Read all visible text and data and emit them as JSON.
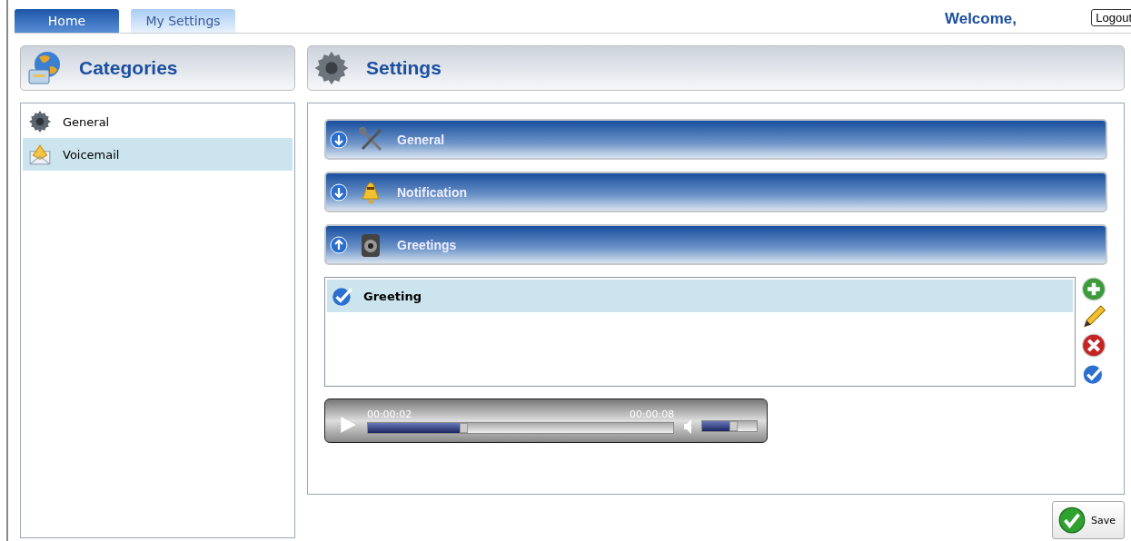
{
  "tabs": [
    {
      "label": "Home",
      "selected": true
    },
    {
      "label": "My Settings",
      "selected": false
    }
  ],
  "welcome": "Welcome,",
  "logout": "Logout",
  "categories": {
    "title": "Categories",
    "items": [
      {
        "label": "General",
        "selected": false
      },
      {
        "label": "Voicemail",
        "selected": true
      }
    ]
  },
  "settings": {
    "title": "Settings",
    "sections": [
      {
        "label": "General",
        "expanded": false
      },
      {
        "label": "Notification",
        "expanded": false
      },
      {
        "label": "Greetings",
        "expanded": true
      }
    ]
  },
  "greetings": [
    {
      "label": "Greeting",
      "selected": true
    }
  ],
  "player": {
    "elapsed": "00:00:02",
    "total": "00:00:08",
    "progress": {
      "level": 0.3
    },
    "volume": {
      "level": 0.5
    }
  },
  "save": "Save"
}
